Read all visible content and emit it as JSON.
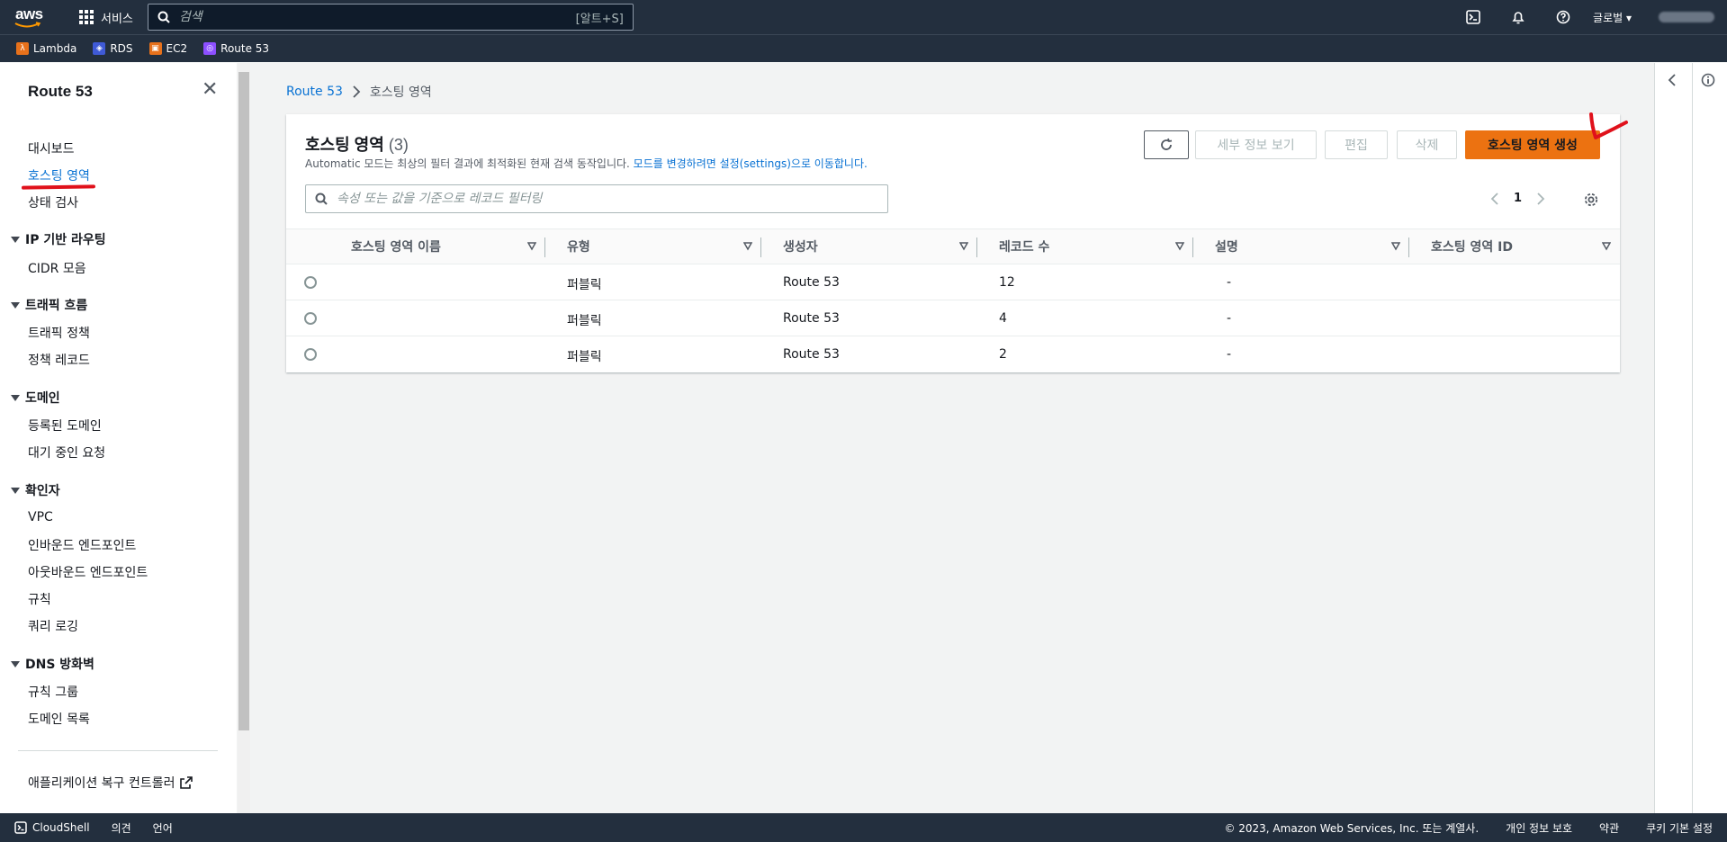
{
  "topnav": {
    "logo_text": "aws",
    "services_label": "서비스",
    "search_placeholder": "검색",
    "search_shortcut": "[알트+S]",
    "region_label": "글로벌 ▾"
  },
  "favorites": [
    {
      "label": "Lambda",
      "color": "#e7711b",
      "icon": "lambda-icon"
    },
    {
      "label": "RDS",
      "color": "#3f5ad6",
      "icon": "rds-icon"
    },
    {
      "label": "EC2",
      "color": "#e7711b",
      "icon": "ec2-icon"
    },
    {
      "label": "Route 53",
      "color": "#8c4fff",
      "icon": "route53-icon"
    }
  ],
  "sidebar": {
    "title": "Route 53",
    "items": {
      "dashboard": "대시보드",
      "hosted_zones": "호스팅 영역",
      "health_checks": "상태 검사",
      "ip_routing": "IP 기반 라우팅",
      "cidr": "CIDR 모음",
      "traffic_flow": "트래픽 흐름",
      "traffic_policy": "트래픽 정책",
      "policy_records": "정책 레코드",
      "domains": "도메인",
      "registered_domains": "등록된 도메인",
      "pending_requests": "대기 중인 요청",
      "resolver": "확인자",
      "vpc": "VPC",
      "inbound_endpoints": "인바운드 엔드포인트",
      "outbound_endpoints": "아웃바운드 엔드포인트",
      "rules": "규칙",
      "query_logging": "쿼리 로깅",
      "dns_firewall": "DNS 방화벽",
      "rule_groups": "규칙 그룹",
      "domain_lists": "도메인 목록",
      "arc": "애플리케이션 복구 컨트롤러"
    }
  },
  "breadcrumb": {
    "root": "Route 53",
    "current": "호스팅 영역"
  },
  "panel": {
    "title": "호스팅 영역",
    "count": "(3)",
    "desc_plain": "Automatic 모드는 최상의 필터 결과에 최적화된 현재 검색 동작입니다. ",
    "desc_link": "모드를 변경하려면 설정(settings)으로 이동합니다.",
    "buttons": {
      "details": "세부 정보 보기",
      "edit": "편집",
      "delete": "삭제",
      "create": "호스팅 영역 생성"
    },
    "filter_placeholder": "속성 또는 값을 기준으로 레코드 필터링",
    "page": "1"
  },
  "table": {
    "columns": [
      "호스팅 영역 이름",
      "유형",
      "생성자",
      "레코드 수",
      "설명",
      "호스팅 영역 ID"
    ],
    "rows": [
      {
        "name": "",
        "type": "퍼블릭",
        "creator": "Route 53",
        "records": "12",
        "desc": "-",
        "id": ""
      },
      {
        "name": "",
        "type": "퍼블릭",
        "creator": "Route 53",
        "records": "4",
        "desc": "-",
        "id": ""
      },
      {
        "name": "",
        "type": "퍼블릭",
        "creator": "Route 53",
        "records": "2",
        "desc": "-",
        "id": ""
      }
    ]
  },
  "footer": {
    "cloudshell": "CloudShell",
    "feedback": "의견",
    "language": "언어",
    "copyright": "© 2023, Amazon Web Services, Inc. 또는 계열사.",
    "privacy": "개인 정보 보호",
    "terms": "약관",
    "cookies": "쿠키 기본 설정"
  }
}
